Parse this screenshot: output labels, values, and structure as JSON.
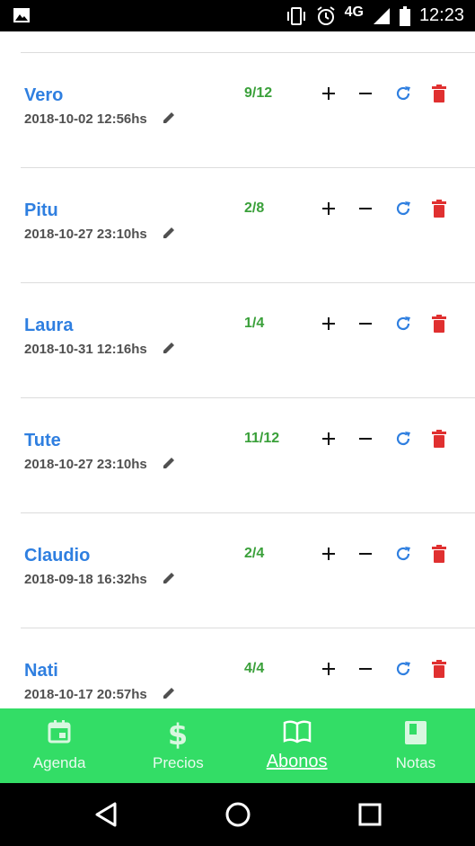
{
  "status": {
    "network": "4G",
    "time": "12:23"
  },
  "entries": [
    {
      "name": "Vero",
      "date": "2018-10-02 12:56hs",
      "count": "9/12"
    },
    {
      "name": "Pitu",
      "date": "2018-10-27 23:10hs",
      "count": "2/8"
    },
    {
      "name": "Laura",
      "date": "2018-10-31 12:16hs",
      "count": "1/4"
    },
    {
      "name": "Tute",
      "date": "2018-10-27 23:10hs",
      "count": "11/12"
    },
    {
      "name": "Claudio",
      "date": "2018-09-18 16:32hs",
      "count": "2/4"
    },
    {
      "name": "Nati",
      "date": "2018-10-17 20:57hs",
      "count": "4/4"
    }
  ],
  "nav": {
    "agenda": "Agenda",
    "precios": "Precios",
    "abonos": "Abonos",
    "notas": "Notas"
  },
  "colors": {
    "accent": "#33dd66",
    "name": "#2f7fe0",
    "count": "#3aa03a",
    "delete": "#e03030"
  }
}
